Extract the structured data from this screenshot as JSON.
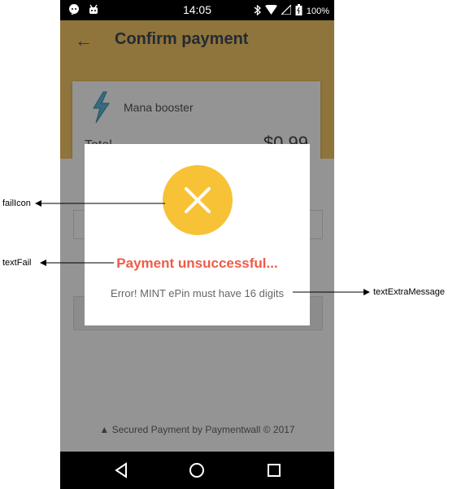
{
  "status_bar": {
    "time": "14:05",
    "battery": "100%"
  },
  "header": {
    "title": "Confirm payment"
  },
  "order": {
    "product": "Mana booster",
    "total_label": "Total",
    "total_value": "$0.99"
  },
  "footer": {
    "text": "Secured Payment by Paymentwall © 2017"
  },
  "dialog": {
    "fail_text": "Payment unsuccessful...",
    "extra_message": "Error! MINT ePin must have 16 digits"
  },
  "annotations": {
    "fail_icon": "failIcon",
    "fail_text": "textFail",
    "extra_message": "textExtraMessage"
  },
  "colors": {
    "header": "#f6c868",
    "fail_icon": "#f7c235",
    "fail_text": "#ef5b48"
  }
}
